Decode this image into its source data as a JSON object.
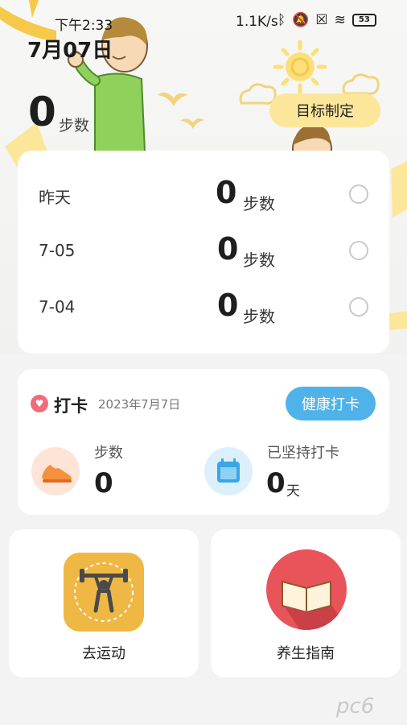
{
  "status_bar": {
    "time": "下午2:33",
    "network_speed": "1.1K/s",
    "battery": "53",
    "icons": [
      "bluetooth-icon",
      "mute-icon",
      "sim-icon",
      "wifi-icon",
      "battery-icon"
    ]
  },
  "header": {
    "date": "7月07日",
    "steps_value": "0",
    "steps_unit": "步数",
    "goal_button": "目标制定"
  },
  "history": [
    {
      "label": "昨天",
      "value": "0",
      "unit": "步数"
    },
    {
      "label": "7-05",
      "value": "0",
      "unit": "步数"
    },
    {
      "label": "7-04",
      "value": "0",
      "unit": "步数"
    }
  ],
  "checkin": {
    "title": "打卡",
    "date": "2023年7月7日",
    "button": "健康打卡",
    "steps_label": "步数",
    "steps_value": "0",
    "streak_label": "已坚持打卡",
    "streak_value": "0",
    "streak_unit": "天"
  },
  "tiles": {
    "exercise": "去运动",
    "health_guide": "养生指南"
  },
  "watermark": "pc6",
  "colors": {
    "goal_button": "#fce69a",
    "health_button": "#4fb3ea",
    "heart": "#f16c78",
    "sport_icon_bg": "#efb844",
    "book_icon_bg": "#e9545a"
  }
}
